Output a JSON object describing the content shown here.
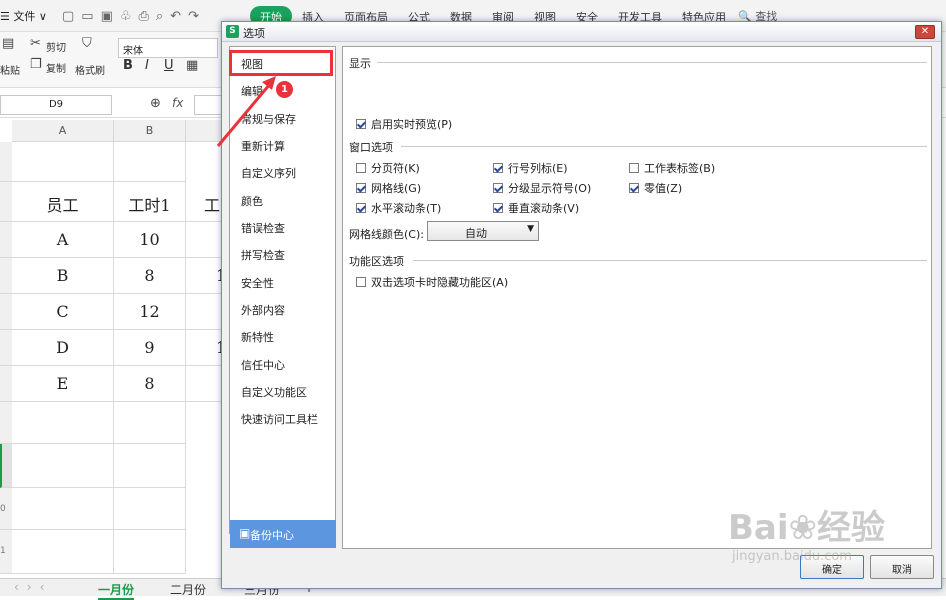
{
  "app": {
    "menubar": {
      "file_label": "☰ 文件 ∨",
      "tabs": [
        "开始",
        "插入",
        "页面布局",
        "公式",
        "数据",
        "审阅",
        "视图",
        "安全",
        "开发工具",
        "特色应用"
      ],
      "search_label": "🔍 查找"
    },
    "toolbar": {
      "cut": "剪切",
      "copy": "复制",
      "paste": "粘贴",
      "format_painter": "格式刷",
      "font_name": "宋体",
      "bold": "B",
      "italic": "I",
      "underline": "U"
    },
    "formula_bar": {
      "name_box": "D9",
      "fx": "fx"
    },
    "columns": [
      "A",
      "B"
    ],
    "table": {
      "headers": [
        "员工",
        "工时1",
        "工"
      ],
      "rows": [
        [
          "A",
          "10",
          ""
        ],
        [
          "B",
          "8",
          "1"
        ],
        [
          "C",
          "12",
          ""
        ],
        [
          "D",
          "9",
          "1"
        ],
        [
          "E",
          "8",
          ""
        ]
      ]
    },
    "row_numbers": [
      "0",
      "1"
    ],
    "sheet_tabs": [
      "一月份",
      "二月份",
      "三月份"
    ],
    "sheet_add": "+"
  },
  "dialog": {
    "title": "选项",
    "app_icon": "S",
    "close_label": "✕",
    "nav": [
      "视图",
      "编辑",
      "常规与保存",
      "重新计算",
      "自定义序列",
      "颜色",
      "错误检查",
      "拼写检查",
      "安全性",
      "外部内容",
      "新特性",
      "信任中心",
      "自定义功能区",
      "快速访问工具栏"
    ],
    "backup_label": "备份中心",
    "backup_icon": "▣",
    "sections": {
      "display_title": "显示",
      "live_preview": "启用实时预览(P)",
      "window_title": "窗口选项",
      "window_options": [
        {
          "label": "分页符(K)",
          "checked": false
        },
        {
          "label": "行号列标(E)",
          "checked": true
        },
        {
          "label": "工作表标签(B)",
          "checked": false
        },
        {
          "label": "网格线(G)",
          "checked": true
        },
        {
          "label": "分级显示符号(O)",
          "checked": true
        },
        {
          "label": "零值(Z)",
          "checked": true
        },
        {
          "label": "水平滚动条(T)",
          "checked": true
        },
        {
          "label": "垂直滚动条(V)",
          "checked": true
        }
      ],
      "grid_color_label": "网格线颜色(C):",
      "grid_color_value": "自动",
      "ribbon_title": "功能区选项",
      "ribbon_hide": "双击选项卡时隐藏功能区(A)"
    },
    "ok_label": "确定",
    "cancel_label": "取消"
  },
  "annotation": {
    "badge": "1",
    "color": "#e8333a"
  },
  "watermark": {
    "main": "Bai❀经验",
    "sub": "jingyan.baidu.com"
  }
}
